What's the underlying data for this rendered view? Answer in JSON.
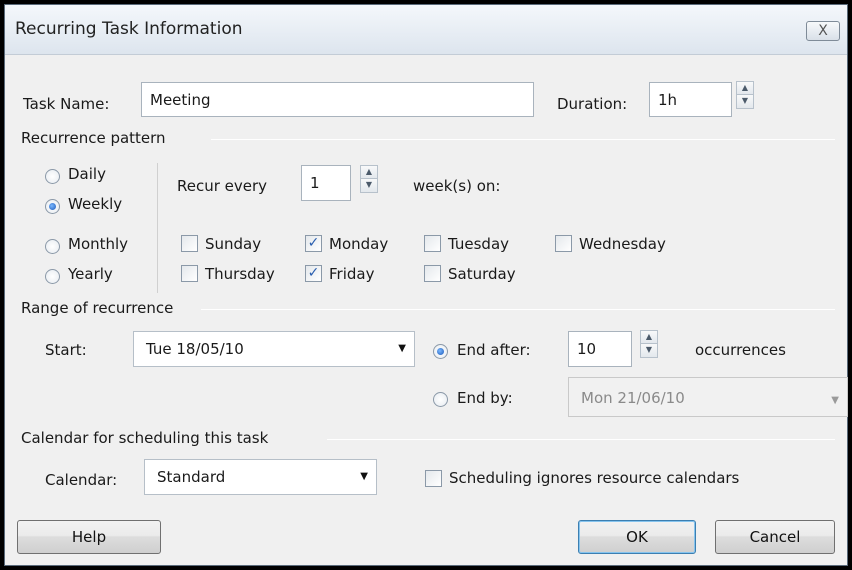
{
  "window": {
    "title": "Recurring Task Information",
    "close_glyph": "X"
  },
  "task": {
    "name_label": "Task Name:",
    "name_value": "Meeting",
    "duration_label": "Duration:",
    "duration_value": "1h"
  },
  "recurrence_pattern": {
    "section_title": "Recurrence pattern",
    "frequency_options": [
      {
        "label": "Daily",
        "checked": false
      },
      {
        "label": "Weekly",
        "checked": true
      },
      {
        "label": "Monthly",
        "checked": false
      },
      {
        "label": "Yearly",
        "checked": false
      }
    ],
    "recur_every_label": "Recur every",
    "recur_every_value": "1",
    "weeks_on_label": "week(s) on:",
    "days": [
      {
        "label": "Sunday",
        "checked": false
      },
      {
        "label": "Monday",
        "checked": true
      },
      {
        "label": "Tuesday",
        "checked": false
      },
      {
        "label": "Wednesday",
        "checked": false
      },
      {
        "label": "Thursday",
        "checked": false
      },
      {
        "label": "Friday",
        "checked": true
      },
      {
        "label": "Saturday",
        "checked": false
      }
    ]
  },
  "range": {
    "section_title": "Range of recurrence",
    "start_label": "Start:",
    "start_value": "Tue 18/05/10",
    "end_after_label": "End after:",
    "end_after_checked": true,
    "occurrences_value": "10",
    "occurrences_label": "occurrences",
    "end_by_label": "End by:",
    "end_by_checked": false,
    "end_by_value": "Mon 21/06/10"
  },
  "calendar": {
    "section_title": "Calendar for scheduling this task",
    "calendar_label": "Calendar:",
    "calendar_value": "Standard",
    "ignore_label": "Scheduling ignores resource calendars",
    "ignore_checked": false
  },
  "buttons": {
    "help": "Help",
    "ok": "OK",
    "cancel": "Cancel"
  },
  "colors": {
    "dialog_bg": "#f0f0f0",
    "accent_check": "#2a5fb0",
    "radio_dot": "#1a57b8"
  }
}
